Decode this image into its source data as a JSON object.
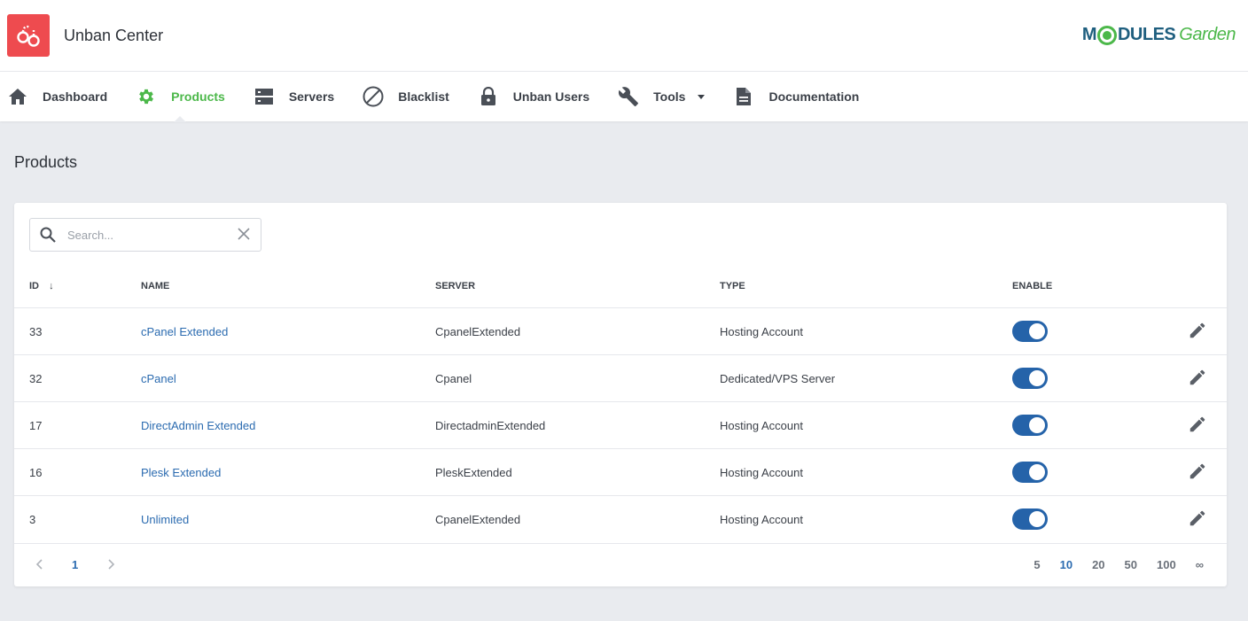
{
  "app": {
    "title": "Unban Center"
  },
  "brand": {
    "part1": "M",
    "part2": "DULES",
    "part3": "Garden"
  },
  "colors": {
    "accent_red": "#ee4b4f",
    "accent_green": "#4cb84a",
    "link_blue": "#2b6bb0",
    "toggle_blue": "#2563a9"
  },
  "nav": {
    "items": [
      {
        "label": "Dashboard",
        "icon": "home-icon"
      },
      {
        "label": "Products",
        "icon": "gear-icon",
        "active": true
      },
      {
        "label": "Servers",
        "icon": "server-icon"
      },
      {
        "label": "Blacklist",
        "icon": "block-icon"
      },
      {
        "label": "Unban Users",
        "icon": "lock-icon"
      },
      {
        "label": "Tools",
        "icon": "wrench-icon",
        "dropdown": true
      },
      {
        "label": "Documentation",
        "icon": "document-icon"
      }
    ]
  },
  "page": {
    "title": "Products"
  },
  "search": {
    "placeholder": "Search..."
  },
  "table": {
    "headers": {
      "id": "ID",
      "name": "NAME",
      "server": "SERVER",
      "type": "TYPE",
      "enable": "ENABLE"
    },
    "sort_indicator": "↓",
    "rows": [
      {
        "id": "33",
        "name": "cPanel Extended",
        "server": "CpanelExtended",
        "type": "Hosting Account",
        "enabled": true
      },
      {
        "id": "32",
        "name": "cPanel",
        "server": "Cpanel",
        "type": "Dedicated/VPS Server",
        "enabled": true
      },
      {
        "id": "17",
        "name": "DirectAdmin Extended",
        "server": "DirectadminExtended",
        "type": "Hosting Account",
        "enabled": true
      },
      {
        "id": "16",
        "name": "Plesk Extended",
        "server": "PleskExtended",
        "type": "Hosting Account",
        "enabled": true
      },
      {
        "id": "3",
        "name": "Unlimited",
        "server": "CpanelExtended",
        "type": "Hosting Account",
        "enabled": true
      }
    ]
  },
  "pagination": {
    "current_page": "1",
    "page_sizes": [
      "5",
      "10",
      "20",
      "50",
      "100",
      "∞"
    ],
    "selected_size": "10"
  }
}
